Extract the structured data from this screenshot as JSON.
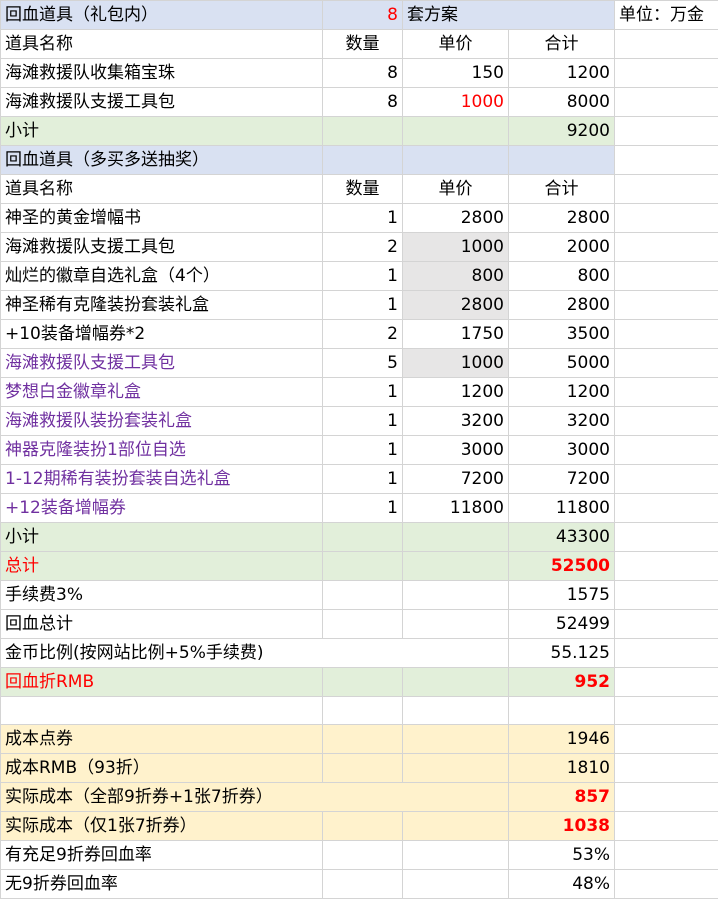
{
  "unit_label": "单位：万金",
  "section1": {
    "title": "回血道具（礼包内）",
    "plan_count": "8",
    "plan_label": "套方案",
    "headers": [
      "道具名称",
      "数量",
      "单价",
      "合计"
    ],
    "rows": [
      {
        "name": "海滩救援队收集箱宝珠",
        "qty": "8",
        "price": "150",
        "total": "1200"
      },
      {
        "name": "海滩救援队支援工具包",
        "qty": "8",
        "price": "1000",
        "total": "8000"
      }
    ],
    "subtotal_label": "小计",
    "subtotal_value": "9200"
  },
  "section2": {
    "title": "回血道具（多买多送抽奖）",
    "headers": [
      "道具名称",
      "数量",
      "单价",
      "合计"
    ],
    "rows": [
      {
        "name": "神圣的黄金增幅书",
        "qty": "1",
        "price": "2800",
        "total": "2800"
      },
      {
        "name": "海滩救援队支援工具包",
        "qty": "2",
        "price": "1000",
        "total": "2000"
      },
      {
        "name": "灿烂的徽章自选礼盒（4个）",
        "qty": "1",
        "price": "800",
        "total": "800"
      },
      {
        "name": "神圣稀有克隆装扮套装礼盒",
        "qty": "1",
        "price": "2800",
        "total": "2800"
      },
      {
        "name": "+10装备增幅券*2",
        "qty": "2",
        "price": "1750",
        "total": "3500"
      },
      {
        "name": "海滩救援队支援工具包",
        "qty": "5",
        "price": "1000",
        "total": "5000"
      },
      {
        "name": "梦想白金徽章礼盒",
        "qty": "1",
        "price": "1200",
        "total": "1200"
      },
      {
        "name": "海滩救援队装扮套装礼盒",
        "qty": "1",
        "price": "3200",
        "total": "3200"
      },
      {
        "name": "神器克隆装扮1部位自选",
        "qty": "1",
        "price": "3000",
        "total": "3000"
      },
      {
        "name": "1-12期稀有装扮套装自选礼盒",
        "qty": "1",
        "price": "7200",
        "total": "7200"
      },
      {
        "name": "+12装备增幅券",
        "qty": "1",
        "price": "11800",
        "total": "11800"
      }
    ],
    "subtotal_label": "小计",
    "subtotal_value": "43300"
  },
  "summary": [
    {
      "label": "总计",
      "value": "52500"
    },
    {
      "label": "手续费3%",
      "value": "1575"
    },
    {
      "label": "回血总计",
      "value": "52499"
    },
    {
      "label": "金币比例(按网站比例+5%手续费)",
      "value": "55.125"
    },
    {
      "label": "回血折RMB",
      "value": "952"
    }
  ],
  "cost": [
    {
      "label": "成本点券",
      "value": "1946"
    },
    {
      "label": "成本RMB（93折）",
      "value": "1810"
    },
    {
      "label": "实际成本（全部9折券+1张7折券）",
      "value": "857"
    },
    {
      "label": "实际成本（仅1张7折券）",
      "value": "1038"
    },
    {
      "label": "有充足9折券回血率",
      "value": "53%"
    },
    {
      "label": "无9折券回血率",
      "value": "48%"
    }
  ],
  "colors": {
    "header_blue": "#d9e1f2",
    "subtotal_green": "#e2efda",
    "cost_yellow": "#fff2cc",
    "highlight_gray": "#e7e6e6",
    "purple_text": "#7030a0",
    "red_text": "#ff0000"
  }
}
